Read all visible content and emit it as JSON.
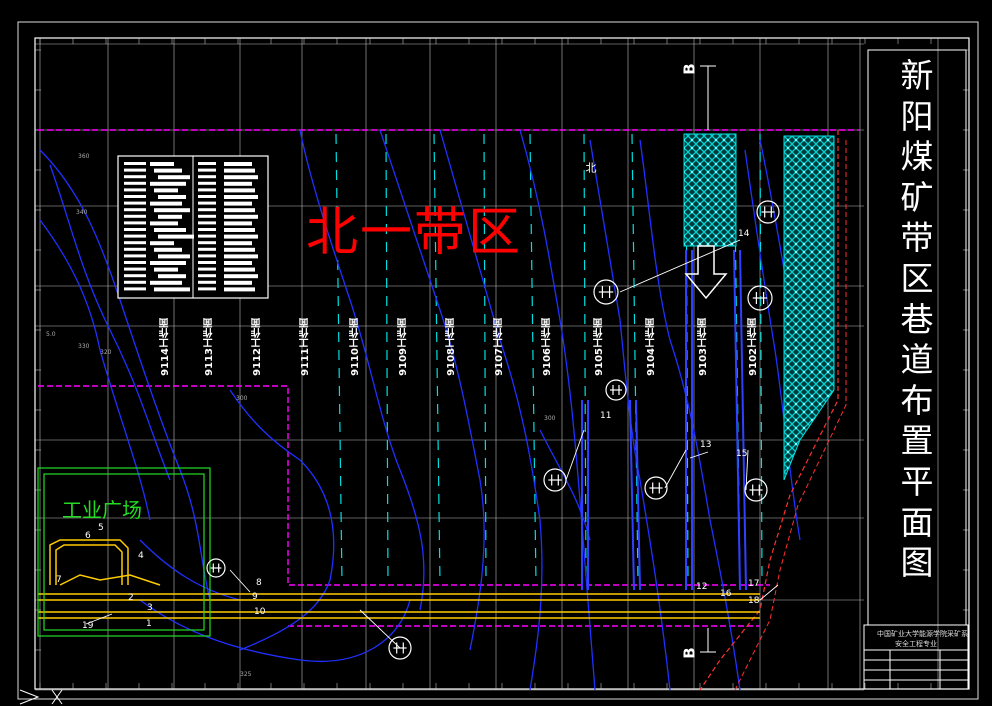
{
  "title_chars": [
    "新",
    "阳",
    "煤",
    "矿",
    "带",
    "区",
    "巷",
    "道",
    "布",
    "置",
    "平",
    "面",
    "图"
  ],
  "region_label": "北一带区",
  "yard_label": "工业广场",
  "section_marker": "B",
  "north_label": "北",
  "workfaces": [
    "9114工作面",
    "9113工作面",
    "9112工作面",
    "9111工作面",
    "9110工作面",
    "9109工作面",
    "9108工作面",
    "9107工作面",
    "9106工作面",
    "9105工作面",
    "9104工作面",
    "9103工作面",
    "9102工作面"
  ],
  "title_block": {
    "line1": "中国矿业大学能源学院采矿系",
    "line2": "安全工程专业"
  },
  "callouts": [
    "1",
    "2",
    "3",
    "4",
    "5",
    "6",
    "7",
    "8",
    "9",
    "10",
    "11",
    "12",
    "13",
    "14",
    "15",
    "16",
    "17",
    "18",
    "19"
  ],
  "colors": {
    "background": "#000000",
    "frame": "#ffffff",
    "grid": "#ffffff",
    "contours": "#2030ff",
    "boundary": "#ff00ff",
    "roadway": "#ffcc00",
    "region_text": "#ff0000",
    "yard": "#22dd22",
    "goaf_fill": "#00c8c8",
    "workface_dash": "#00e0e0"
  }
}
